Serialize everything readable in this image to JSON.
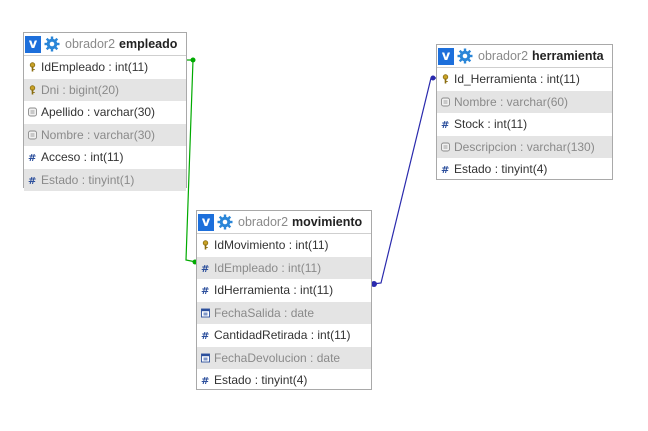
{
  "colors": {
    "link_empleado": "#00aa00",
    "link_herramienta": "#2a2aad",
    "header_v": "#1d6fdb"
  },
  "tables": {
    "empleado": {
      "db": "obrador2",
      "name": "empleado",
      "fields": [
        {
          "text": "IdEmpleado : int(11)",
          "icon": "key-icon"
        },
        {
          "text": "Dni : bigint(20)",
          "icon": "key-icon"
        },
        {
          "text": "Apellido : varchar(30)",
          "icon": "text-field-icon"
        },
        {
          "text": "Nombre : varchar(30)",
          "icon": "text-field-icon"
        },
        {
          "text": "Acceso : int(11)",
          "icon": "numeric-field-icon"
        },
        {
          "text": "Estado : tinyint(1)",
          "icon": "numeric-field-icon"
        }
      ]
    },
    "herramienta": {
      "db": "obrador2",
      "name": "herramienta",
      "fields": [
        {
          "text": "Id_Herramienta : int(11)",
          "icon": "key-icon"
        },
        {
          "text": "Nombre : varchar(60)",
          "icon": "text-field-icon"
        },
        {
          "text": "Stock : int(11)",
          "icon": "numeric-field-icon"
        },
        {
          "text": "Descripcion : varchar(130)",
          "icon": "text-field-icon"
        },
        {
          "text": "Estado : tinyint(4)",
          "icon": "numeric-field-icon"
        }
      ]
    },
    "movimiento": {
      "db": "obrador2",
      "name": "movimiento",
      "fields": [
        {
          "text": "IdMovimiento : int(11)",
          "icon": "key-icon"
        },
        {
          "text": "IdEmpleado : int(11)",
          "icon": "numeric-field-icon"
        },
        {
          "text": "IdHerramienta : int(11)",
          "icon": "numeric-field-icon"
        },
        {
          "text": "FechaSalida : date",
          "icon": "date-field-icon"
        },
        {
          "text": "CantidadRetirada : int(11)",
          "icon": "numeric-field-icon"
        },
        {
          "text": "FechaDevolucion : date",
          "icon": "date-field-icon"
        },
        {
          "text": "Estado : tinyint(4)",
          "icon": "numeric-field-icon"
        }
      ]
    }
  }
}
